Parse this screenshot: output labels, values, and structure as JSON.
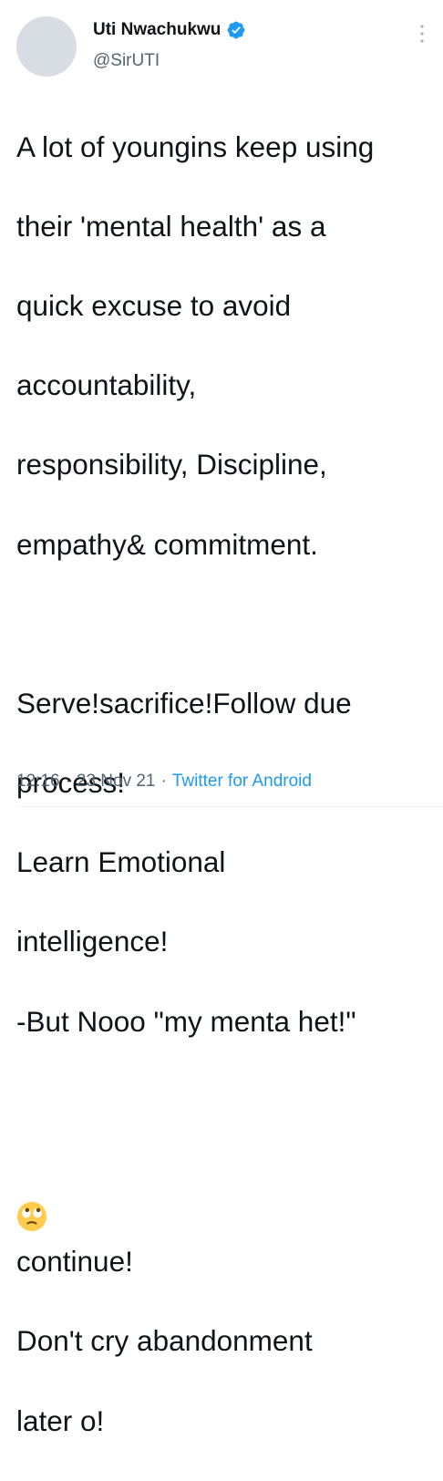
{
  "author": {
    "display_name": "Uti Nwachukwu",
    "handle": "@SirUTI",
    "verified_icon": "verified-badge-icon"
  },
  "tweet": {
    "lines": [
      "A lot of youngins keep using",
      "their 'mental health' as a",
      "quick excuse to avoid",
      "accountability,",
      "responsibility, Discipline,",
      "empathy& commitment.",
      "",
      "Serve!sacrifice!Follow due",
      "process!",
      "Learn Emotional",
      "intelligence!",
      "-But Nooo \"my menta het!\"",
      ""
    ],
    "emoji_line_text": "continue!",
    "emoji_icon": "face-with-rolling-eyes-icon",
    "closing_lines": [
      "Don't cry abandonment",
      "later o!"
    ]
  },
  "meta": {
    "time": "12:16",
    "separator1": "·",
    "date": "23 Nov 21",
    "separator2": "·",
    "source": "Twitter for Android"
  },
  "colors": {
    "accent": "#1d9bf0",
    "text": "#0f1419",
    "secondary": "#536471"
  }
}
